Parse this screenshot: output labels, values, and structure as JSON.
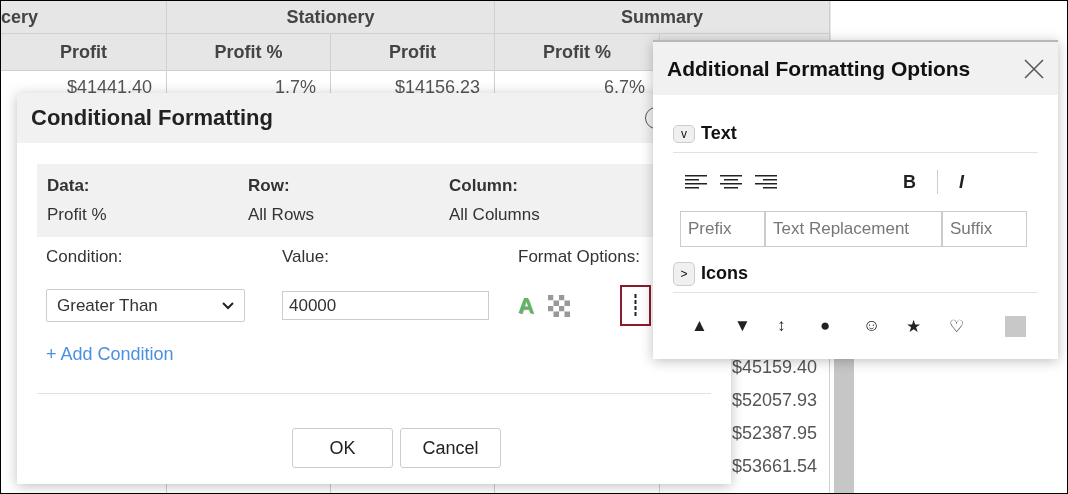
{
  "table": {
    "group_headers": [
      "cery",
      "Stationery",
      "Summary"
    ],
    "column_headers": [
      "Profit",
      "Profit %",
      "Profit",
      "Profit %"
    ],
    "first_row": [
      "$41441.40",
      "1.7%",
      "$14156.23",
      "6.7%"
    ],
    "summary_values": [
      "$45159.40",
      "$52057.93",
      "$52387.95",
      "$53661.54"
    ]
  },
  "conditional": {
    "title": "Conditional Formatting",
    "info": [
      {
        "label": "Data:",
        "value": "Profit %"
      },
      {
        "label": "Row:",
        "value": "All Rows"
      },
      {
        "label": "Column:",
        "value": "All Columns"
      }
    ],
    "condition_label": "Condition:",
    "value_label": "Value:",
    "format_label": "Format Options:",
    "condition": "Greater Than",
    "value": "40000",
    "font_color_letter": "A",
    "more_button": {
      "selected": true
    },
    "add_condition": "+ Add Condition",
    "buttons": [
      "OK",
      "Cancel"
    ]
  },
  "additional": {
    "title": "Additional Formatting Options",
    "text_section": {
      "toggle": "v",
      "label": "Text",
      "expanded": true
    },
    "bold": "B",
    "italic": "I",
    "fields": [
      {
        "placeholder": "Prefix"
      },
      {
        "placeholder": "Text Replacement"
      },
      {
        "placeholder": "Suffix"
      }
    ],
    "icons_section": {
      "toggle": ">",
      "label": "Icons",
      "expanded": false
    },
    "icons": [
      {
        "kind": "glyph",
        "glyph": "▲"
      },
      {
        "kind": "glyph",
        "glyph": "▼"
      },
      {
        "kind": "glyph",
        "glyph": "↕"
      },
      {
        "kind": "glyph",
        "glyph": "●"
      },
      {
        "kind": "glyph",
        "glyph": "☺"
      },
      {
        "kind": "glyph",
        "glyph": "★"
      },
      {
        "kind": "glyph",
        "glyph": "♡"
      },
      {
        "kind": "swatch",
        "color": "#c8c8c8"
      }
    ]
  }
}
